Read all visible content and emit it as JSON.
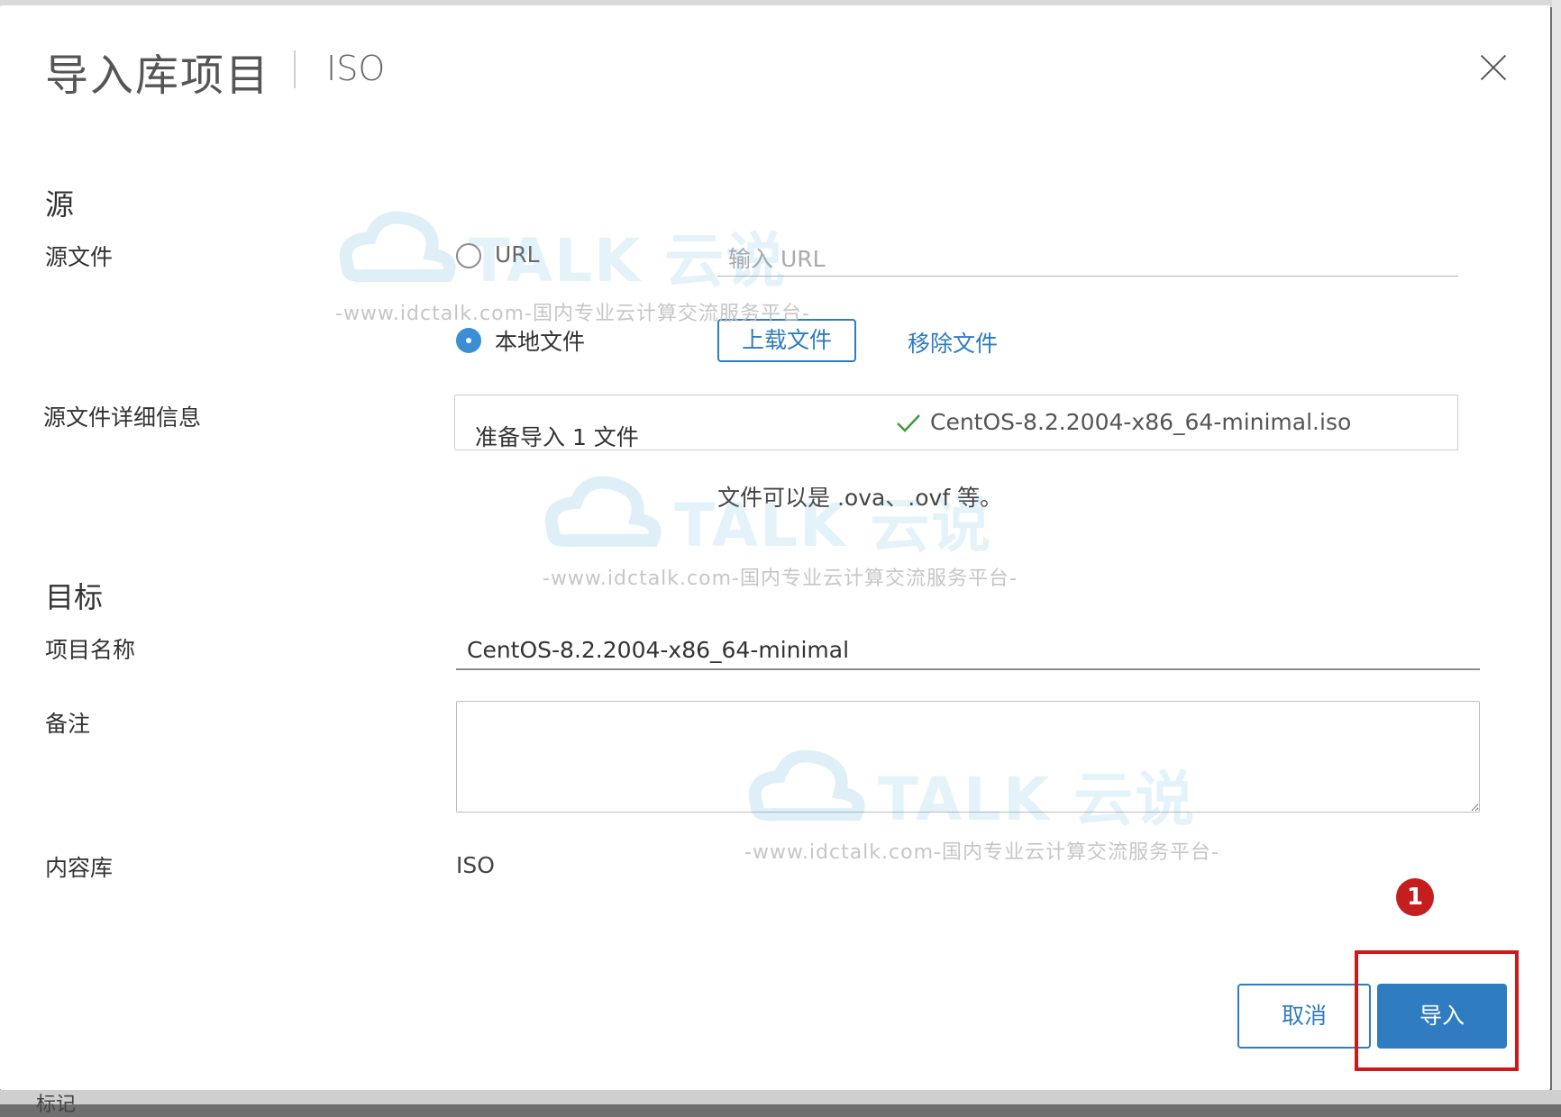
{
  "dialog": {
    "title": "导入库项目",
    "subtitle": "ISO",
    "close_icon": "close-icon"
  },
  "source": {
    "heading": "源",
    "file_label": "源文件",
    "option_url": "URL",
    "url_placeholder": "输入 URL",
    "option_local": "本地文件",
    "selected_option": "本地文件",
    "upload_button": "上载文件",
    "remove_link": "移除文件",
    "details_label": "源文件详细信息",
    "details_status": "准备导入 1 文件",
    "details_filename": "CentOS-8.2.2004-x86_64-minimal.iso",
    "hint": "文件可以是 .ova、.ovf 等。"
  },
  "target": {
    "heading": "目标",
    "item_name_label": "项目名称",
    "item_name_value": "CentOS-8.2.2004-x86_64-minimal",
    "notes_label": "备注",
    "notes_value": "",
    "library_label": "内容库",
    "library_value": "ISO"
  },
  "footer": {
    "cancel_button": "取消",
    "import_button": "导入"
  },
  "annotation": {
    "step_number": "1",
    "highlight_color": "#d01818"
  },
  "watermark": {
    "brand": "TALK 云说",
    "url": "-www.idctalk.com-国内专业云计算交流服务平台-"
  },
  "background": {
    "bottom_label": "标记"
  },
  "colors": {
    "accent": "#2f7cc0",
    "radio_checked": "#3b8ed4",
    "success_check": "#3c9a3c"
  }
}
